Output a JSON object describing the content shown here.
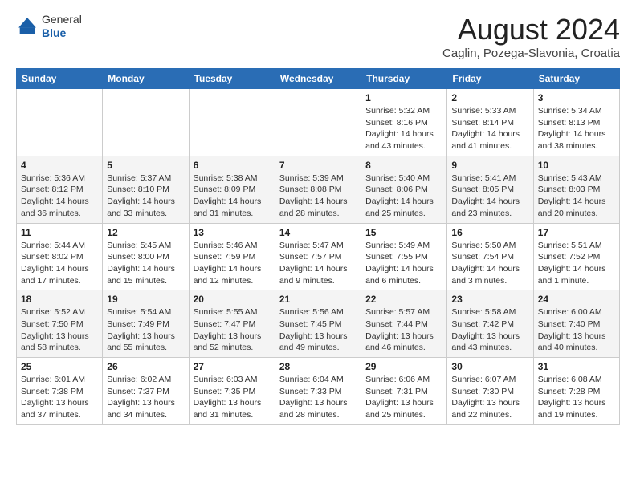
{
  "header": {
    "logo_line1": "General",
    "logo_line2": "Blue",
    "title": "August 2024",
    "subtitle": "Caglin, Pozega-Slavonia, Croatia"
  },
  "calendar": {
    "days_of_week": [
      "Sunday",
      "Monday",
      "Tuesday",
      "Wednesday",
      "Thursday",
      "Friday",
      "Saturday"
    ],
    "weeks": [
      [
        {
          "day": "",
          "info": ""
        },
        {
          "day": "",
          "info": ""
        },
        {
          "day": "",
          "info": ""
        },
        {
          "day": "",
          "info": ""
        },
        {
          "day": "1",
          "info": "Sunrise: 5:32 AM\nSunset: 8:16 PM\nDaylight: 14 hours\nand 43 minutes."
        },
        {
          "day": "2",
          "info": "Sunrise: 5:33 AM\nSunset: 8:14 PM\nDaylight: 14 hours\nand 41 minutes."
        },
        {
          "day": "3",
          "info": "Sunrise: 5:34 AM\nSunset: 8:13 PM\nDaylight: 14 hours\nand 38 minutes."
        }
      ],
      [
        {
          "day": "4",
          "info": "Sunrise: 5:36 AM\nSunset: 8:12 PM\nDaylight: 14 hours\nand 36 minutes."
        },
        {
          "day": "5",
          "info": "Sunrise: 5:37 AM\nSunset: 8:10 PM\nDaylight: 14 hours\nand 33 minutes."
        },
        {
          "day": "6",
          "info": "Sunrise: 5:38 AM\nSunset: 8:09 PM\nDaylight: 14 hours\nand 31 minutes."
        },
        {
          "day": "7",
          "info": "Sunrise: 5:39 AM\nSunset: 8:08 PM\nDaylight: 14 hours\nand 28 minutes."
        },
        {
          "day": "8",
          "info": "Sunrise: 5:40 AM\nSunset: 8:06 PM\nDaylight: 14 hours\nand 25 minutes."
        },
        {
          "day": "9",
          "info": "Sunrise: 5:41 AM\nSunset: 8:05 PM\nDaylight: 14 hours\nand 23 minutes."
        },
        {
          "day": "10",
          "info": "Sunrise: 5:43 AM\nSunset: 8:03 PM\nDaylight: 14 hours\nand 20 minutes."
        }
      ],
      [
        {
          "day": "11",
          "info": "Sunrise: 5:44 AM\nSunset: 8:02 PM\nDaylight: 14 hours\nand 17 minutes."
        },
        {
          "day": "12",
          "info": "Sunrise: 5:45 AM\nSunset: 8:00 PM\nDaylight: 14 hours\nand 15 minutes."
        },
        {
          "day": "13",
          "info": "Sunrise: 5:46 AM\nSunset: 7:59 PM\nDaylight: 14 hours\nand 12 minutes."
        },
        {
          "day": "14",
          "info": "Sunrise: 5:47 AM\nSunset: 7:57 PM\nDaylight: 14 hours\nand 9 minutes."
        },
        {
          "day": "15",
          "info": "Sunrise: 5:49 AM\nSunset: 7:55 PM\nDaylight: 14 hours\nand 6 minutes."
        },
        {
          "day": "16",
          "info": "Sunrise: 5:50 AM\nSunset: 7:54 PM\nDaylight: 14 hours\nand 3 minutes."
        },
        {
          "day": "17",
          "info": "Sunrise: 5:51 AM\nSunset: 7:52 PM\nDaylight: 14 hours\nand 1 minute."
        }
      ],
      [
        {
          "day": "18",
          "info": "Sunrise: 5:52 AM\nSunset: 7:50 PM\nDaylight: 13 hours\nand 58 minutes."
        },
        {
          "day": "19",
          "info": "Sunrise: 5:54 AM\nSunset: 7:49 PM\nDaylight: 13 hours\nand 55 minutes."
        },
        {
          "day": "20",
          "info": "Sunrise: 5:55 AM\nSunset: 7:47 PM\nDaylight: 13 hours\nand 52 minutes."
        },
        {
          "day": "21",
          "info": "Sunrise: 5:56 AM\nSunset: 7:45 PM\nDaylight: 13 hours\nand 49 minutes."
        },
        {
          "day": "22",
          "info": "Sunrise: 5:57 AM\nSunset: 7:44 PM\nDaylight: 13 hours\nand 46 minutes."
        },
        {
          "day": "23",
          "info": "Sunrise: 5:58 AM\nSunset: 7:42 PM\nDaylight: 13 hours\nand 43 minutes."
        },
        {
          "day": "24",
          "info": "Sunrise: 6:00 AM\nSunset: 7:40 PM\nDaylight: 13 hours\nand 40 minutes."
        }
      ],
      [
        {
          "day": "25",
          "info": "Sunrise: 6:01 AM\nSunset: 7:38 PM\nDaylight: 13 hours\nand 37 minutes."
        },
        {
          "day": "26",
          "info": "Sunrise: 6:02 AM\nSunset: 7:37 PM\nDaylight: 13 hours\nand 34 minutes."
        },
        {
          "day": "27",
          "info": "Sunrise: 6:03 AM\nSunset: 7:35 PM\nDaylight: 13 hours\nand 31 minutes."
        },
        {
          "day": "28",
          "info": "Sunrise: 6:04 AM\nSunset: 7:33 PM\nDaylight: 13 hours\nand 28 minutes."
        },
        {
          "day": "29",
          "info": "Sunrise: 6:06 AM\nSunset: 7:31 PM\nDaylight: 13 hours\nand 25 minutes."
        },
        {
          "day": "30",
          "info": "Sunrise: 6:07 AM\nSunset: 7:30 PM\nDaylight: 13 hours\nand 22 minutes."
        },
        {
          "day": "31",
          "info": "Sunrise: 6:08 AM\nSunset: 7:28 PM\nDaylight: 13 hours\nand 19 minutes."
        }
      ]
    ]
  }
}
